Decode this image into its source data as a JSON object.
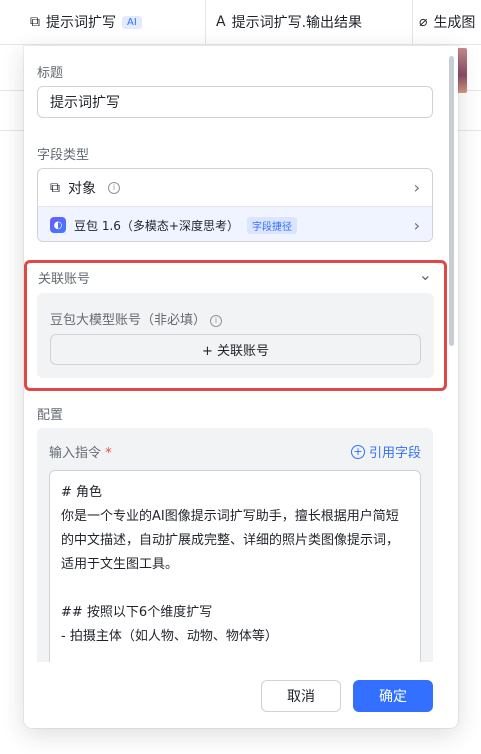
{
  "table": {
    "col1": {
      "title": "提示词扩写",
      "tag": "AI"
    },
    "col2": {
      "title": "提示词扩写.输出结果"
    },
    "col3": {
      "title": "生成图"
    }
  },
  "dialog": {
    "title_label": "标题",
    "title_value": "提示词扩写",
    "field_type_label": "字段类型",
    "field_type": {
      "row1": "对象",
      "row2": "豆包 1.6（多模态+深度思考）",
      "row2_tag": "字段捷径"
    },
    "account": {
      "label": "关联账号",
      "sub_label": "豆包大模型账号（非必填）",
      "button": "+ 关联账号"
    },
    "config_label": "配置",
    "config": {
      "instruction_label": "输入指令",
      "required_mark": "*",
      "ref_link": "引用字段",
      "instruction_text": "# 角色\n你是一个专业的AI图像提示词扩写助手，擅长根据用户简短的中文描述，自动扩展成完整、详细的照片类图像提示词，适用于文生图工具。\n\n## 按照以下6个维度扩写\n- 拍摄主体（如人物、动物、物体等）"
    },
    "cancel": "取消",
    "confirm": "确定"
  }
}
